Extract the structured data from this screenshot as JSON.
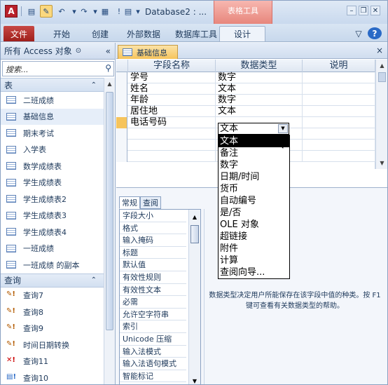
{
  "titlebar": {
    "app_icon": "A",
    "title": "Database2 : ...",
    "context_tab": "表格工具",
    "quick_access": [
      "save-icon",
      "undo-icon",
      "redo-icon",
      "customize-icon"
    ]
  },
  "ribbon": {
    "tabs": [
      "文件",
      "开始",
      "创建",
      "外部数据",
      "数据库工具",
      "设计"
    ]
  },
  "nav": {
    "header": "所有 Access 对象",
    "search_placeholder": "搜索...",
    "groups": {
      "tables": "表",
      "queries": "查询"
    },
    "tables": [
      "二班成绩",
      "基础信息",
      "期末考试",
      "入学表",
      "数学成绩表",
      "学生成绩表",
      "学生成绩表2",
      "学生成绩表3",
      "学生成绩表4",
      "一班成绩",
      "一班成绩 的副本"
    ],
    "queries": [
      "查询7",
      "查询8",
      "查询9",
      "时间日期转换",
      "查询11",
      "查询10"
    ]
  },
  "document": {
    "tab_label": "基础信息",
    "close": "×",
    "columns": [
      "字段名称",
      "数据类型",
      "说明"
    ],
    "rows": [
      {
        "name": "学号",
        "type": "数字"
      },
      {
        "name": "姓名",
        "type": "文本"
      },
      {
        "name": "年龄",
        "type": "数字"
      },
      {
        "name": "居住地",
        "type": "文本"
      },
      {
        "name": "电话号码",
        "type": "文本"
      }
    ],
    "dropdown_options": [
      "文本",
      "备注",
      "数字",
      "日期/时间",
      "货币",
      "自动编号",
      "是/否",
      "OLE 对象",
      "超链接",
      "附件",
      "计算",
      "查阅向导..."
    ]
  },
  "properties": {
    "tabs": [
      "常规",
      "查阅"
    ],
    "items": [
      "字段大小",
      "格式",
      "输入掩码",
      "标题",
      "默认值",
      "有效性规则",
      "有效性文本",
      "必需",
      "允许空字符串",
      "索引",
      "Unicode 压缩",
      "输入法模式",
      "输入法语句模式",
      "智能标记"
    ],
    "help_text": "数据类型决定用户所能保存在该字段中值的种类。按 F1 键可查看有关数据类型的帮助。"
  }
}
